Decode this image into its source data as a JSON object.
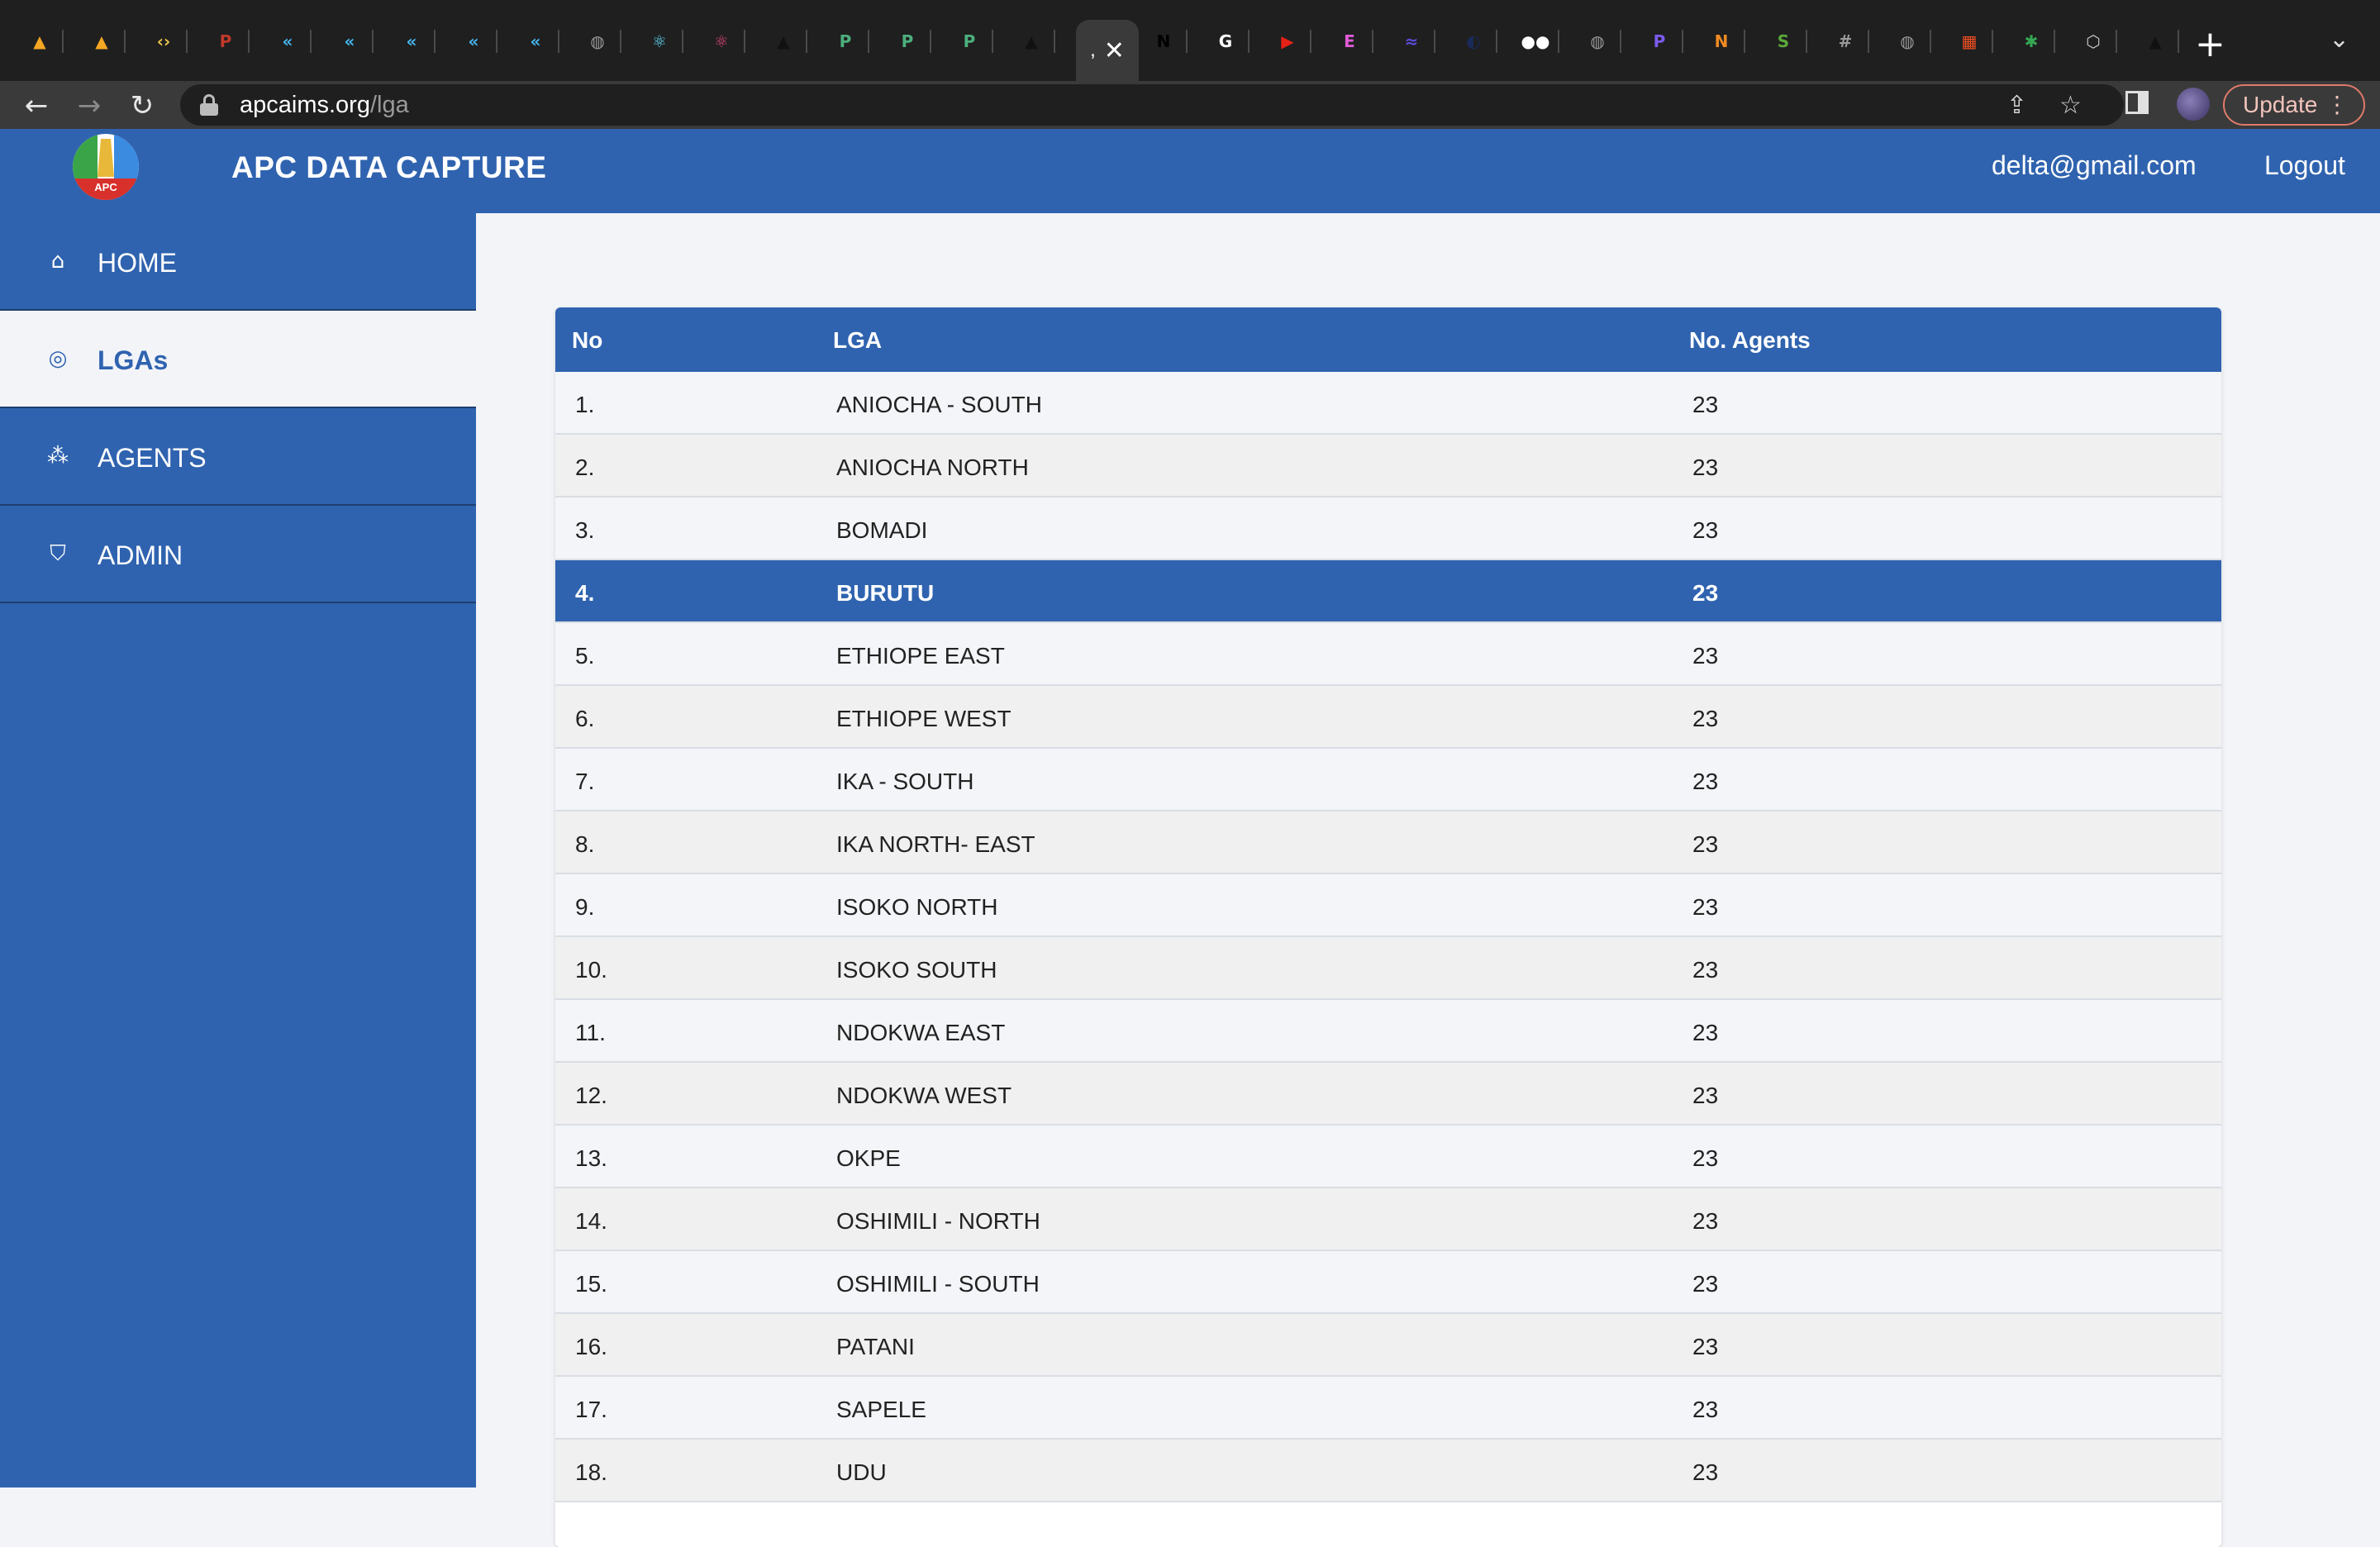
{
  "browser": {
    "tabs": [
      {
        "icon": "firebase-icon",
        "color": "#f5a623",
        "glyph": "▲"
      },
      {
        "icon": "firebase-icon",
        "color": "#f5a623",
        "glyph": "▲"
      },
      {
        "icon": "code-icon",
        "color": "#e8c24a",
        "glyph": "‹›"
      },
      {
        "icon": "pd-icon",
        "color": "#c0392b",
        "glyph": "P"
      },
      {
        "icon": "flutter-icon",
        "color": "#45b6f0",
        "glyph": "«"
      },
      {
        "icon": "flutter-icon",
        "color": "#45b6f0",
        "glyph": "«"
      },
      {
        "icon": "flutter-icon",
        "color": "#45b6f0",
        "glyph": "«"
      },
      {
        "icon": "flutter-icon",
        "color": "#45b6f0",
        "glyph": "«"
      },
      {
        "icon": "flutter-icon",
        "color": "#45b6f0",
        "glyph": "«"
      },
      {
        "icon": "globe-icon",
        "color": "#9a9a9a",
        "glyph": "◍"
      },
      {
        "icon": "react-icon",
        "color": "#61dafb",
        "glyph": "⚛"
      },
      {
        "icon": "react-icon",
        "color": "#e0457b",
        "glyph": "⚛"
      },
      {
        "icon": "triangle-icon",
        "color": "#111111",
        "glyph": "▲"
      },
      {
        "icon": "doc-icon",
        "color": "#4caf7d",
        "glyph": "P"
      },
      {
        "icon": "doc-icon",
        "color": "#4caf7d",
        "glyph": "P"
      },
      {
        "icon": "doc-icon",
        "color": "#4caf7d",
        "glyph": "P"
      },
      {
        "icon": "triangle-icon",
        "color": "#111111",
        "glyph": "▲"
      }
    ],
    "active_tab_glyph": ",",
    "active_tab_close": "✕",
    "tabs_after": [
      {
        "icon": "next-icon",
        "color": "#000000",
        "glyph": "N"
      },
      {
        "icon": "google-icon",
        "color": "#ffffff",
        "glyph": "G"
      },
      {
        "icon": "youtube-icon",
        "color": "#e62117",
        "glyph": "▶"
      },
      {
        "icon": "app-icon",
        "color": "#e05ad8",
        "glyph": "E"
      },
      {
        "icon": "wave-icon",
        "color": "#5b4cdb",
        "glyph": "≈"
      },
      {
        "icon": "dark-icon",
        "color": "#1a2a5a",
        "glyph": "◐"
      },
      {
        "icon": "medium-icon",
        "color": "#ffffff",
        "glyph": "●●"
      },
      {
        "icon": "globe-icon",
        "color": "#9a9a9a",
        "glyph": "◍"
      },
      {
        "icon": "p-icon",
        "color": "#7b5cf0",
        "glyph": "P"
      },
      {
        "icon": "nuz-icon",
        "color": "#f08a24",
        "glyph": "N"
      },
      {
        "icon": "shopify-icon",
        "color": "#5aa83a",
        "glyph": "S"
      },
      {
        "icon": "grid-icon",
        "color": "#9a9a9a",
        "glyph": "#"
      },
      {
        "icon": "globe-icon",
        "color": "#9a9a9a",
        "glyph": "◍"
      },
      {
        "icon": "microsoft-icon",
        "color": "#f25022",
        "glyph": "▦"
      },
      {
        "icon": "pin-icon",
        "color": "#34a853",
        "glyph": "✱"
      },
      {
        "icon": "box-icon",
        "color": "#cccccc",
        "glyph": "⬡"
      },
      {
        "icon": "triangle-icon",
        "color": "#111111",
        "glyph": "▲"
      }
    ],
    "new_tab": "+",
    "tab_menu": "⌄",
    "back": "←",
    "forward": "→",
    "reload": "↻",
    "url_host": "apcaims.org",
    "url_path": "/lga",
    "share_icon": "⇪",
    "star_icon": "☆",
    "update_label": "Update",
    "menu_dots": "⋮"
  },
  "app": {
    "title": "APC DATA CAPTURE",
    "logo_text": "APC",
    "user_email": "delta@gmail.com",
    "logout_label": "Logout",
    "brand_color": "#2f63af"
  },
  "sidebar": {
    "items": [
      {
        "label": "HOME",
        "icon": "home-icon",
        "glyph": "⌂"
      },
      {
        "label": "LGAs",
        "icon": "location-icon",
        "glyph": "◎"
      },
      {
        "label": "AGENTS",
        "icon": "group-icon",
        "glyph": "⁂"
      },
      {
        "label": "ADMIN",
        "icon": "admin-shield-icon",
        "glyph": "⛉"
      }
    ]
  },
  "table": {
    "headers": {
      "no": "No",
      "lga": "LGA",
      "agents": "No. Agents"
    },
    "rows": [
      {
        "no": "1.",
        "lga": "ANIOCHA - SOUTH",
        "agents": "23"
      },
      {
        "no": "2.",
        "lga": "ANIOCHA NORTH",
        "agents": "23"
      },
      {
        "no": "3.",
        "lga": "BOMADI",
        "agents": "23"
      },
      {
        "no": "4.",
        "lga": "BURUTU",
        "agents": "23"
      },
      {
        "no": "5.",
        "lga": "ETHIOPE EAST",
        "agents": "23"
      },
      {
        "no": "6.",
        "lga": "ETHIOPE WEST",
        "agents": "23"
      },
      {
        "no": "7.",
        "lga": "IKA - SOUTH",
        "agents": "23"
      },
      {
        "no": "8.",
        "lga": "IKA NORTH- EAST",
        "agents": "23"
      },
      {
        "no": "9.",
        "lga": "ISOKO NORTH",
        "agents": "23"
      },
      {
        "no": "10.",
        "lga": "ISOKO SOUTH",
        "agents": "23"
      },
      {
        "no": "11.",
        "lga": "NDOKWA EAST",
        "agents": "23"
      },
      {
        "no": "12.",
        "lga": "NDOKWA WEST",
        "agents": "23"
      },
      {
        "no": "13.",
        "lga": "OKPE",
        "agents": "23"
      },
      {
        "no": "14.",
        "lga": "OSHIMILI - NORTH",
        "agents": "23"
      },
      {
        "no": "15.",
        "lga": "OSHIMILI - SOUTH",
        "agents": "23"
      },
      {
        "no": "16.",
        "lga": "PATANI",
        "agents": "23"
      },
      {
        "no": "17.",
        "lga": "SAPELE",
        "agents": "23"
      },
      {
        "no": "18.",
        "lga": "UDU",
        "agents": "23"
      }
    ]
  }
}
